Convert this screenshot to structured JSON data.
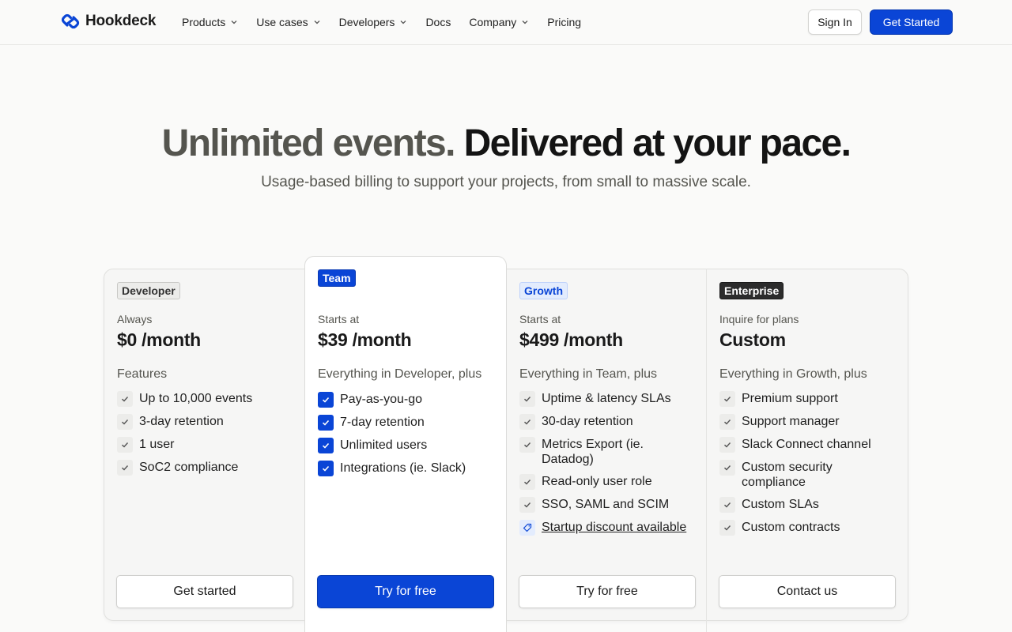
{
  "brand": {
    "name": "Hookdeck",
    "accent": "#0a45d6"
  },
  "nav": {
    "items": [
      {
        "label": "Products",
        "dropdown": true
      },
      {
        "label": "Use cases",
        "dropdown": true
      },
      {
        "label": "Developers",
        "dropdown": true
      },
      {
        "label": "Docs",
        "dropdown": false
      },
      {
        "label": "Company",
        "dropdown": true
      },
      {
        "label": "Pricing",
        "dropdown": false
      }
    ],
    "sign_in": "Sign In",
    "get_started": "Get Started"
  },
  "hero": {
    "title_muted": "Unlimited events.",
    "title_dark": "Delivered at your pace.",
    "subtitle": "Usage-based billing to support your projects, from small to massive scale."
  },
  "plans": [
    {
      "badge": "Developer",
      "sub": "Always",
      "price": "$0 /month",
      "features_head": "Features",
      "features": [
        "Up to 10,000 events",
        "3-day retention",
        "1 user",
        "SoC2 compliance"
      ],
      "button": "Get started"
    },
    {
      "badge": "Team",
      "sub": "Starts at",
      "price": "$39 /month",
      "features_head": "Everything in Developer, plus",
      "features": [
        "Pay-as-you-go",
        "7-day retention",
        "Unlimited users",
        "Integrations (ie. Slack)"
      ],
      "button": "Try for free"
    },
    {
      "badge": "Growth",
      "sub": "Starts at",
      "price": "$499 /month",
      "features_head": "Everything in Team, plus",
      "features": [
        "Uptime & latency SLAs",
        "30-day retention",
        "Metrics Export (ie. Datadog)",
        "Read-only user role",
        "SSO, SAML and SCIM"
      ],
      "link": "Startup discount available",
      "button": "Try for free"
    },
    {
      "badge": "Enterprise",
      "sub": "Inquire for plans",
      "price": "Custom",
      "features_head": "Everything in Growth, plus",
      "features": [
        "Premium support",
        "Support manager",
        "Slack Connect channel",
        "Custom security compliance",
        "Custom SLAs",
        "Custom contracts"
      ],
      "button": "Contact us"
    }
  ]
}
